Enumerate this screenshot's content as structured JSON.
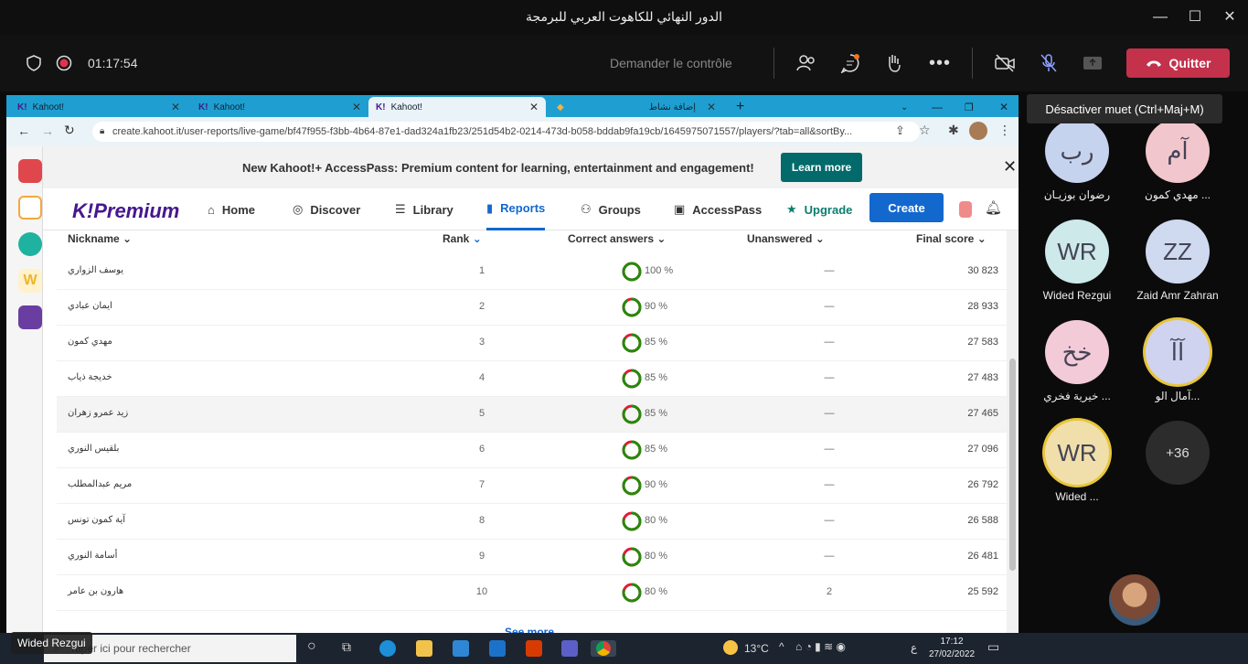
{
  "window": {
    "title": "الدور النهائي للكاهوت العربي للبرمجة"
  },
  "meeting": {
    "timer": "01:17:54",
    "request_control": "Demander le contrôle",
    "quit_label": "Quitter",
    "tooltip": "Désactiver muet (Ctrl+Maj+M)"
  },
  "browser": {
    "tabs": [
      {
        "label": "Kahoot!"
      },
      {
        "label": "Kahoot!"
      },
      {
        "label": "Kahoot!"
      },
      {
        "label": "إضافة نشاط"
      }
    ],
    "url": "create.kahoot.it/user-reports/live-game/bf47f955-f3bb-4b64-87e1-dad324a1fb23/251d54b2-0214-473d-b058-bddab9fa19cb/1645975071557/players/?tab=all&sortBy..."
  },
  "banner": {
    "message": "New Kahoot!+ AccessPass: Premium content for learning, entertainment and engagement!",
    "learn_more": "Learn more"
  },
  "nav": {
    "logo": "K!Premium",
    "items": [
      {
        "label": "Home"
      },
      {
        "label": "Discover"
      },
      {
        "label": "Library"
      },
      {
        "label": "Reports"
      },
      {
        "label": "Groups"
      },
      {
        "label": "AccessPass"
      },
      {
        "label": "Upgrade"
      }
    ],
    "create": "Create"
  },
  "table": {
    "headers": {
      "nickname": "Nickname",
      "rank": "Rank",
      "correct": "Correct answers",
      "unanswered": "Unanswered",
      "final_score": "Final score"
    },
    "rows": [
      {
        "nickname": "يوسف الزواري",
        "rank": "1",
        "correct": "100 %",
        "correct_value": 100,
        "unanswered": "—",
        "score": "30 823"
      },
      {
        "nickname": "ايمان عبادي",
        "rank": "2",
        "correct": "90 %",
        "correct_value": 90,
        "unanswered": "—",
        "score": "28 933"
      },
      {
        "nickname": "مهدي كمون",
        "rank": "3",
        "correct": "85 %",
        "correct_value": 85,
        "unanswered": "—",
        "score": "27 583"
      },
      {
        "nickname": "خديجة ذياب",
        "rank": "4",
        "correct": "85 %",
        "correct_value": 85,
        "unanswered": "—",
        "score": "27 483"
      },
      {
        "nickname": "زيد عمرو زهران",
        "rank": "5",
        "correct": "85 %",
        "correct_value": 85,
        "unanswered": "—",
        "score": "27 465"
      },
      {
        "nickname": "بلقيس النوري",
        "rank": "6",
        "correct": "85 %",
        "correct_value": 85,
        "unanswered": "—",
        "score": "27 096"
      },
      {
        "nickname": "مريم عبدالمطلب",
        "rank": "7",
        "correct": "90 %",
        "correct_value": 90,
        "unanswered": "—",
        "score": "26 792"
      },
      {
        "nickname": "آية كمون تونس",
        "rank": "8",
        "correct": "80 %",
        "correct_value": 80,
        "unanswered": "—",
        "score": "26 588"
      },
      {
        "nickname": "أسامة النوري",
        "rank": "9",
        "correct": "80 %",
        "correct_value": 80,
        "unanswered": "—",
        "score": "26 481"
      },
      {
        "nickname": "هارون بن عامر",
        "rank": "10",
        "correct": "80 %",
        "correct_value": 80,
        "unanswered": "2",
        "score": "25 592"
      }
    ],
    "see_more": "See more"
  },
  "participants": [
    {
      "initials": "رب",
      "name": "رضوان بوزيـان",
      "color": "#c6d3ee"
    },
    {
      "initials": "آم",
      "name": "مهدي كمون ...",
      "color": "#f2c6cd"
    },
    {
      "initials": "WR",
      "name": "Wided Rezgui",
      "color": "#cde9ea"
    },
    {
      "initials": "ZZ",
      "name": "Zaid Amr Zahran",
      "color": "#cfd9ef"
    },
    {
      "initials": "خخ",
      "name": "خيرية فخري ...",
      "color": "#f3cad8"
    },
    {
      "initials": "آآ",
      "name": "آمال الو...",
      "color": "#cfd3f0"
    },
    {
      "initials": "WR",
      "name": "Wided ...",
      "color": "#f0dfaa"
    },
    {
      "initials": "+36",
      "name": "",
      "color": "#2c2c2c"
    }
  ],
  "taskbar": {
    "search_placeholder": "Taper ici pour rechercher",
    "weather": "13°C",
    "time": "17:12",
    "date": "27/02/2022",
    "lang": "ع"
  },
  "self_label": "Wided Rezgui"
}
